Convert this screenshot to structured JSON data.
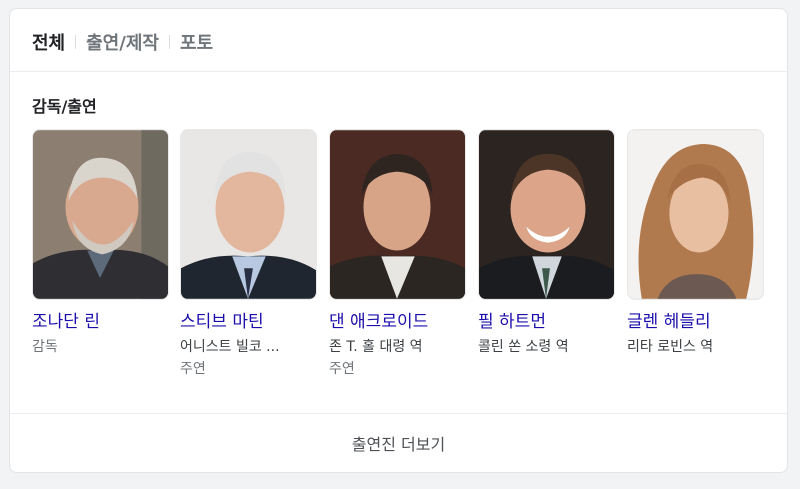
{
  "tabs": [
    {
      "label": "전체",
      "active": true
    },
    {
      "label": "출연/제작",
      "active": false
    },
    {
      "label": "포토",
      "active": false
    }
  ],
  "section_title": "감독/출연",
  "cast": [
    {
      "name": "조나단 린",
      "role": "",
      "sub": "감독"
    },
    {
      "name": "스티브 마틴",
      "role": "어니스트 빌코 ...",
      "sub": "주연"
    },
    {
      "name": "댄 애크로이드",
      "role": "존 T. 홀 대령 역",
      "sub": "주연"
    },
    {
      "name": "필 하트먼",
      "role": "콜린 쏜 소령 역",
      "sub": ""
    },
    {
      "name": "글렌 헤들리",
      "role": "리타 로빈스 역",
      "sub": ""
    }
  ],
  "more_label": "출연진 더보기",
  "colors": {
    "link": "#1a0dab",
    "muted": "#70757a"
  }
}
